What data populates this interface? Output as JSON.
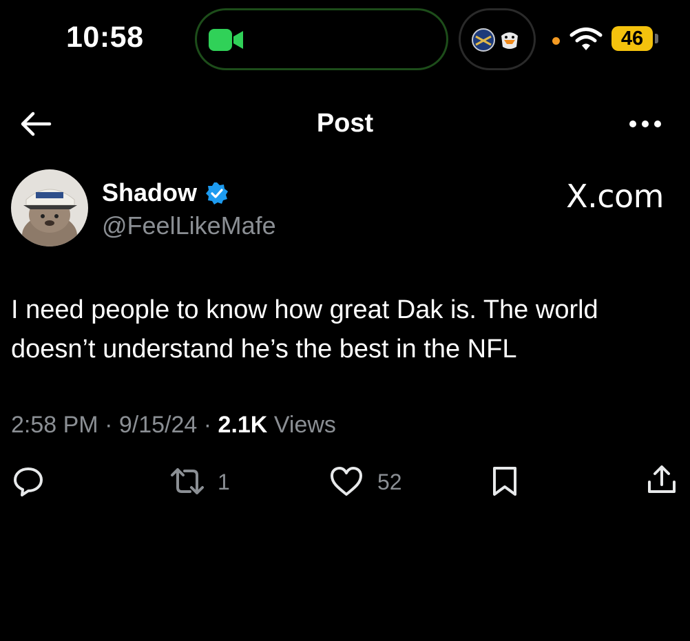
{
  "status_bar": {
    "time": "10:58",
    "battery": "46",
    "icons": [
      "facetime-video-icon",
      "sabres-logo-icon",
      "ducks-logo-icon",
      "wifi-icon",
      "battery-icon"
    ],
    "accent_colors": {
      "call_green": "#30d158",
      "dot_orange": "#f39a22",
      "battery_yellow": "#f4c20d"
    }
  },
  "header": {
    "title": "Post",
    "icons": [
      "back-arrow-icon",
      "more-options-icon"
    ]
  },
  "post": {
    "author_name": "Shadow",
    "author_handle": "@FeelLikeMafe",
    "verified": true,
    "watermark": "X.com",
    "text": "I need people to know how great Dak is. The world doesn’t understand he’s the best in the NFL",
    "time": "2:58 PM",
    "date": "9/15/24",
    "views_count": "2.1K",
    "views_label": "Views",
    "separator": "·"
  },
  "actions": {
    "retweet_count": "1",
    "like_count": "52",
    "icons": [
      "reply-icon",
      "retweet-icon",
      "like-icon",
      "bookmark-icon",
      "share-icon"
    ]
  },
  "colors": {
    "background": "#000000",
    "text_primary": "#ffffff",
    "text_secondary": "#8b8f94",
    "verified_blue": "#1d9bf0"
  }
}
